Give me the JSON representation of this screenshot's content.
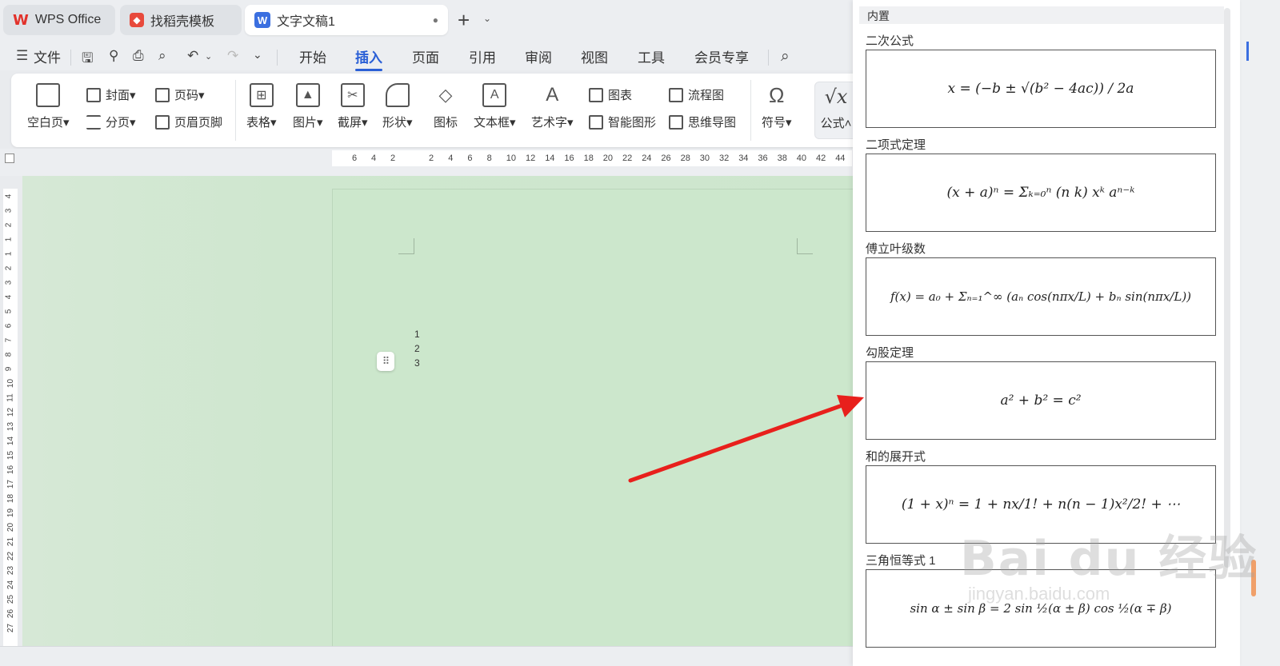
{
  "tabs": {
    "wps_office": "WPS Office",
    "template": "找稻壳模板",
    "doc": "文字文稿1",
    "new_tab": "+",
    "new_tab_dd": "⌄"
  },
  "menu": {
    "file": "文件",
    "items": [
      "开始",
      "插入",
      "页面",
      "引用",
      "审阅",
      "视图",
      "工具",
      "会员专享"
    ],
    "active": "插入"
  },
  "ribbon": {
    "blank_page": "空白页",
    "cover": "封面",
    "page_number": "页码",
    "section_break": "分页",
    "header_footer": "页眉页脚",
    "table": "表格",
    "picture": "图片",
    "screenshot": "截屏",
    "shape": "形状",
    "icon": "图标",
    "textbox": "文本框",
    "wordart": "艺术字",
    "chart": "图表",
    "smartart": "智能图形",
    "flowchart": "流程图",
    "mindmap": "思维导图",
    "symbol": "符号",
    "formula": "公式"
  },
  "ruler": {
    "horizontal": [
      "6",
      "4",
      "2",
      "2",
      "4",
      "6",
      "8",
      "10",
      "12",
      "14",
      "16",
      "18",
      "20",
      "22",
      "24",
      "26",
      "28",
      "30",
      "32",
      "34",
      "36",
      "38",
      "40",
      "42",
      "44"
    ],
    "vertical": [
      "4",
      "3",
      "2",
      "1",
      "1",
      "2",
      "3",
      "4",
      "5",
      "6",
      "7",
      "8",
      "9",
      "10",
      "11",
      "12",
      "13",
      "14",
      "15",
      "16",
      "17",
      "18",
      "19",
      "20",
      "21",
      "22",
      "23",
      "24",
      "25",
      "26",
      "27"
    ]
  },
  "document": {
    "list": [
      "1",
      "2",
      "3"
    ]
  },
  "panel": {
    "header": "内置",
    "formulas": [
      {
        "title": "二次公式",
        "expr": "x = (−b ± √(b² − 4ac)) / 2a"
      },
      {
        "title": "二项式定理",
        "expr": "(x + a)ⁿ = Σₖ₌₀ⁿ (n k) xᵏ aⁿ⁻ᵏ"
      },
      {
        "title": "傅立叶级数",
        "expr": "f(x) = a₀ + Σₙ₌₁^∞ (aₙ cos(nπx/L) + bₙ sin(nπx/L))"
      },
      {
        "title": "勾股定理",
        "expr": "a² + b² = c²"
      },
      {
        "title": "和的展开式",
        "expr": "(1 + x)ⁿ = 1 + nx/1! + n(n − 1)x²/2! + ⋯"
      },
      {
        "title": "三角恒等式 1",
        "expr": "sin α ± sin β = 2 sin ½(α ± β) cos ½(α ∓ β)"
      }
    ]
  },
  "watermark": {
    "brand": "Bai du 经验",
    "url": "jingyan.baidu.com"
  },
  "colors": {
    "accent": "#2a5fd6",
    "arrow": "#e8201c",
    "page_bg": "#cce7cc"
  }
}
